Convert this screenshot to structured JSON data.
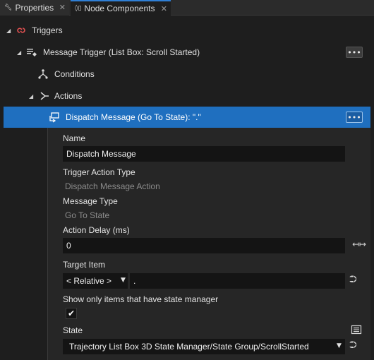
{
  "colors": {
    "selection": "#1f6fbf",
    "active_tab_accent": "#2f7fd5",
    "triggers_icon": "#e05050",
    "background": "#1e1e1e"
  },
  "tabs": [
    {
      "label": "Properties",
      "icon": "wrench-icon",
      "close": "✕"
    },
    {
      "label": "Node Components",
      "icon": "node-components-icon",
      "close": "✕"
    }
  ],
  "tree": {
    "triggers": {
      "label": "Triggers",
      "icon": "triggers-icon"
    },
    "message_trigger": {
      "label": "Message Trigger (List Box: Scroll Started)",
      "more": "•••"
    },
    "conditions": {
      "label": "Conditions"
    },
    "actions": {
      "label": "Actions"
    },
    "dispatch": {
      "label": "Dispatch Message (Go To State): \".\"",
      "more": "•••"
    }
  },
  "properties": {
    "name": {
      "label": "Name",
      "value": "Dispatch Message"
    },
    "trigger_action_type": {
      "label": "Trigger Action Type",
      "value": "Dispatch Message Action"
    },
    "message_type": {
      "label": "Message Type",
      "value": "Go To State"
    },
    "action_delay": {
      "label": "Action Delay (ms)",
      "value": "0"
    },
    "target_item": {
      "label": "Target Item",
      "selected": "< Relative >",
      "path": "."
    },
    "state_manager_filter": {
      "label": "Show only items that have state manager",
      "checked": true
    },
    "state": {
      "label": "State",
      "value": "Trajectory List Box 3D State Manager/State Group/ScrollStarted"
    }
  }
}
